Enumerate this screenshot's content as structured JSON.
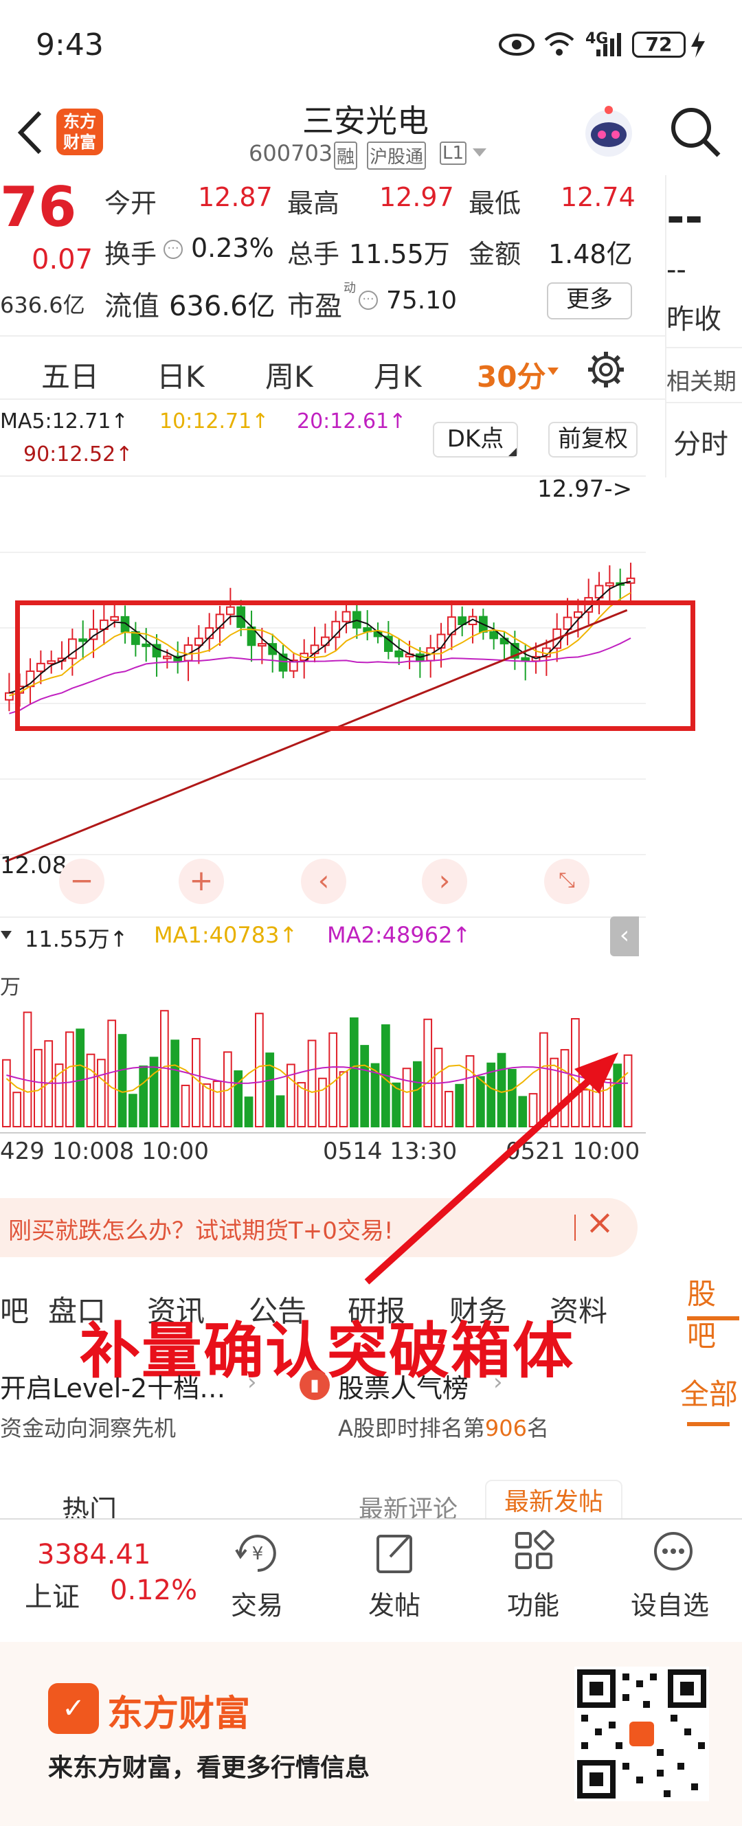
{
  "status_bar": {
    "time": "9:43",
    "network": "4G",
    "battery": "72"
  },
  "header": {
    "back": "back",
    "logo_text": "东方\n财富",
    "stock_name": "三安光电",
    "stock_code": "600703",
    "tags": [
      "融",
      "沪股通",
      "L1"
    ],
    "search": "search"
  },
  "quote": {
    "price_partial": "76",
    "change_partial": ".07",
    "change_prefix": "0.07",
    "cap_partial": "636.6亿",
    "open_label": "今开",
    "open_value": "12.87",
    "high_label": "最高",
    "high_value": "12.97",
    "low_label": "最低",
    "low_value": "12.74",
    "turnover_label": "换手",
    "turnover_value": "0.23%",
    "volume_label": "总手",
    "volume_value": "11.55万",
    "amount_label": "金额",
    "amount_value": "1.48亿",
    "float_label": "流值",
    "float_value": "636.6亿",
    "pe_label": "市盈",
    "pe_sup": "动",
    "pe_value": "75.10",
    "more_label": "更多",
    "right_dash": "--",
    "right_dash2": "--",
    "right_label": "昨收"
  },
  "period_tabs": [
    "五日",
    "日K",
    "周K",
    "月K",
    "30分"
  ],
  "period_active": "30分",
  "right_panel": {
    "related": "相关期",
    "time_share": "分时"
  },
  "ma_line": {
    "ma5": "MA5:12.71↑",
    "ma10": "10:12.71↑",
    "ma20": "20:12.61↑",
    "ma90": "90:12.52↑",
    "dk_label": "DK点",
    "fq_label": "前复权"
  },
  "chart": {
    "high_marker": "12.97->",
    "low_marker": "12.08",
    "vol_label": "11.55万↑",
    "ma1": "MA1:40783↑",
    "ma2": "MA2:48962↑",
    "vol_unit": "万",
    "time_labels": [
      "429 10:00",
      "08 10:00",
      "0514 13:30",
      "0521 10:00"
    ],
    "annotation": "补量确认突破箱体"
  },
  "chart_data": {
    "type": "bar",
    "title": "",
    "candle_count": 60,
    "colors": {
      "up": "#e0202a",
      "down": "#1aa32a",
      "ma5": "#111111",
      "ma10": "#f0b400",
      "ma20": "#c020c0",
      "ma90": "#b01818"
    }
  },
  "banner": {
    "text": "刚买就跌怎么办？试试期货T+0交易!",
    "close": "×"
  },
  "sub_tabs": [
    "吧",
    "盘口",
    "资讯",
    "公告",
    "研报",
    "财务",
    "资料"
  ],
  "right_sub": {
    "guba": "股吧",
    "all": "全部"
  },
  "promo": {
    "left_title": "开启Level-2十档…",
    "left_sub": "资金动向洞察先机",
    "right_title": "股票人气榜",
    "right_sub_prefix": "A股即时排名第",
    "right_rank": "906",
    "right_sub_suffix": "名"
  },
  "comments": {
    "hot": "热门",
    "latest_comment": "最新评论",
    "latest_post": "最新发帖"
  },
  "bottom_bar": {
    "index_value": "3384.41",
    "index_name": "上证",
    "index_change": "0.12%",
    "trade": "交易",
    "post": "发帖",
    "functions": "功能",
    "watchlist": "设自选"
  },
  "footer": {
    "brand": "东方财富",
    "slogan": "来东方财富，看更多行情信息"
  }
}
